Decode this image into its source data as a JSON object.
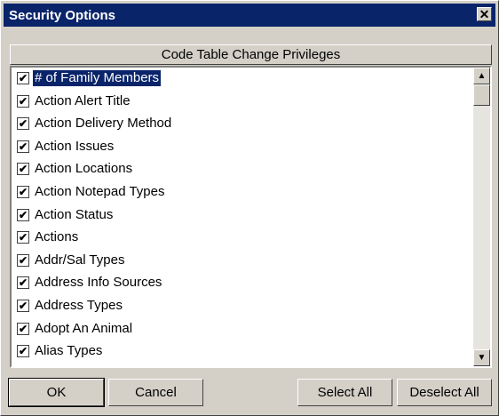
{
  "window": {
    "title": "Security Options",
    "close_label": "✕"
  },
  "list": {
    "header": "Code Table Change Privileges",
    "items": [
      {
        "label": "# of Family Members",
        "checked": true,
        "selected": true
      },
      {
        "label": "Action Alert Title",
        "checked": true
      },
      {
        "label": "Action Delivery Method",
        "checked": true
      },
      {
        "label": "Action Issues",
        "checked": true
      },
      {
        "label": "Action Locations",
        "checked": true
      },
      {
        "label": "Action Notepad Types",
        "checked": true
      },
      {
        "label": "Action Status",
        "checked": true
      },
      {
        "label": "Actions",
        "checked": true
      },
      {
        "label": "Addr/Sal Types",
        "checked": true
      },
      {
        "label": "Address Info Sources",
        "checked": true
      },
      {
        "label": "Address Types",
        "checked": true
      },
      {
        "label": "Adopt An Animal",
        "checked": true
      },
      {
        "label": "Alias Types",
        "checked": true
      }
    ],
    "check_glyph": "✔",
    "scroll_up_glyph": "▲",
    "scroll_down_glyph": "▼"
  },
  "buttons": {
    "ok": "OK",
    "cancel": "Cancel",
    "select_all": "Select All",
    "deselect_all": "Deselect All"
  },
  "colors": {
    "selection": "#0a246a",
    "face": "#d4d0c8"
  }
}
